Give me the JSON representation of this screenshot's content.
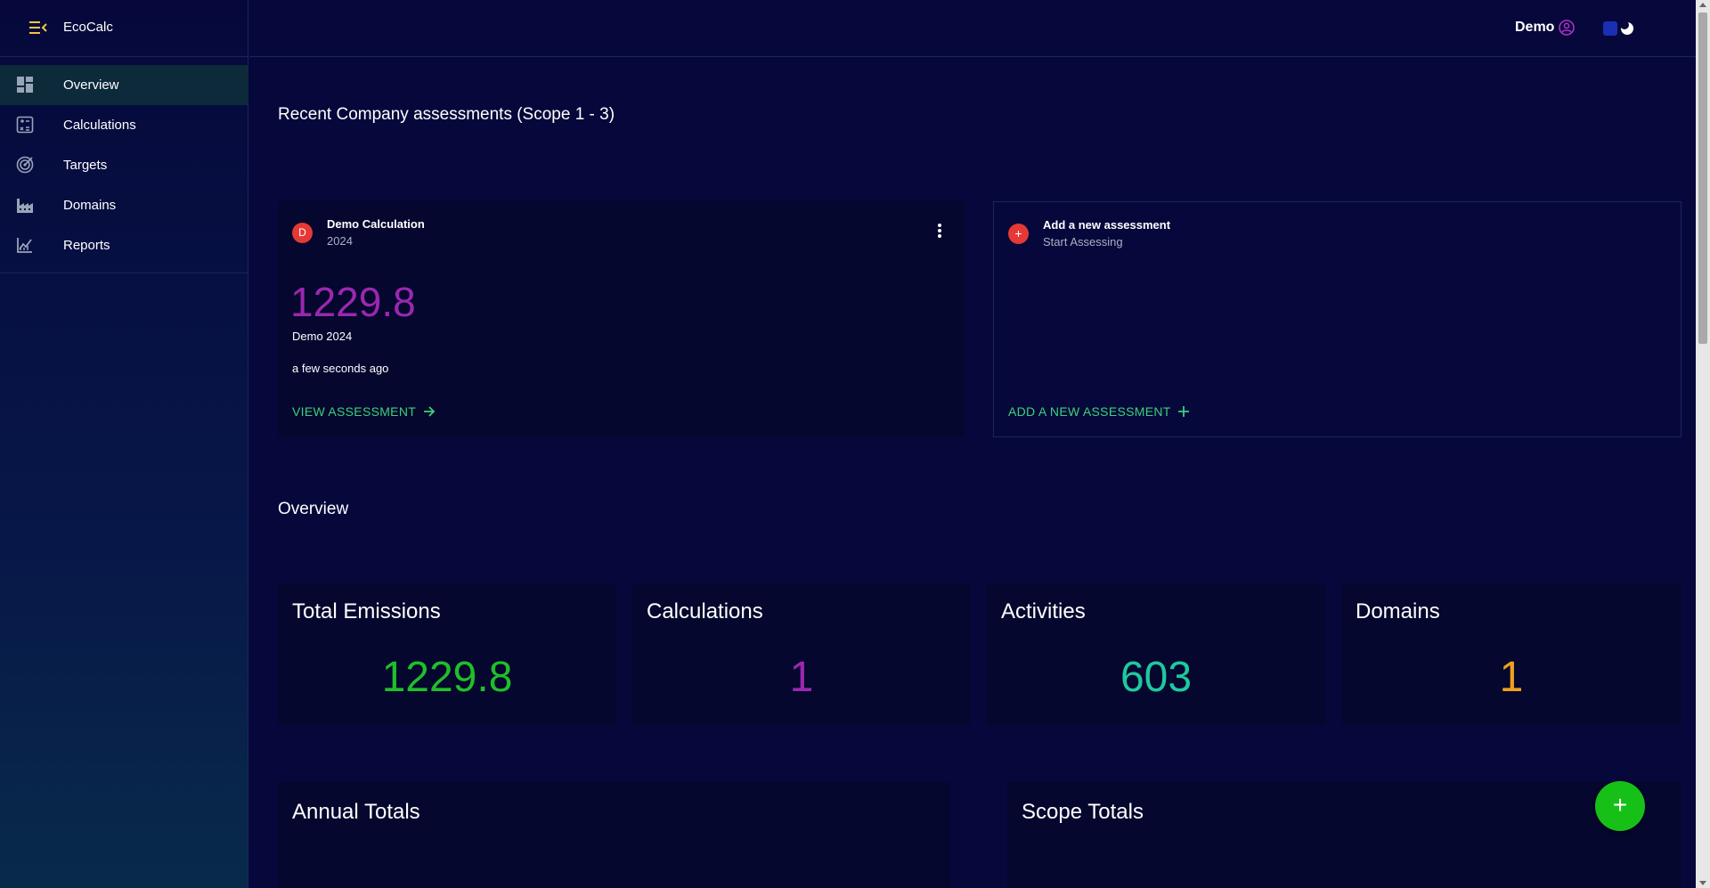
{
  "app": {
    "name": "EcoCalc"
  },
  "sidebar": {
    "items": [
      {
        "label": "Overview",
        "icon": "dashboard-icon",
        "active": true
      },
      {
        "label": "Calculations",
        "icon": "calculator-icon"
      },
      {
        "label": "Targets",
        "icon": "target-icon"
      },
      {
        "label": "Domains",
        "icon": "factory-icon"
      },
      {
        "label": "Reports",
        "icon": "chart-icon"
      }
    ]
  },
  "topbar": {
    "user": "Demo",
    "user_icon": "account-circle-icon",
    "theme_icon": "moon-toggle-icon"
  },
  "recent": {
    "heading": "Recent Company assessments (Scope 1 - 3)",
    "card": {
      "avatar": "D",
      "title": "Demo Calculation",
      "year": "2024",
      "value": "1229.8",
      "name": "Demo 2024",
      "time": "a few seconds ago",
      "link": "VIEW ASSESSMENT"
    },
    "add_card": {
      "avatar": "+",
      "title": "Add a new assessment",
      "subtitle": "Start Assessing",
      "link": "ADD A NEW ASSESSMENT"
    }
  },
  "overview": {
    "heading": "Overview",
    "stats": [
      {
        "label": "Total Emissions",
        "value": "1229.8",
        "color": "#1fbf2a"
      },
      {
        "label": "Calculations",
        "value": "1",
        "color": "#9c27b0"
      },
      {
        "label": "Activities",
        "value": "603",
        "color": "#1ec9a0"
      },
      {
        "label": "Domains",
        "value": "1",
        "color": "#f0a020"
      }
    ]
  },
  "panels": {
    "annual": "Annual Totals",
    "scope": "Scope Totals"
  },
  "fab": {
    "label": "+"
  },
  "colors": {
    "accent_green": "#3cd07a",
    "avatar_red": "#e53935",
    "bg": "#06083b"
  }
}
